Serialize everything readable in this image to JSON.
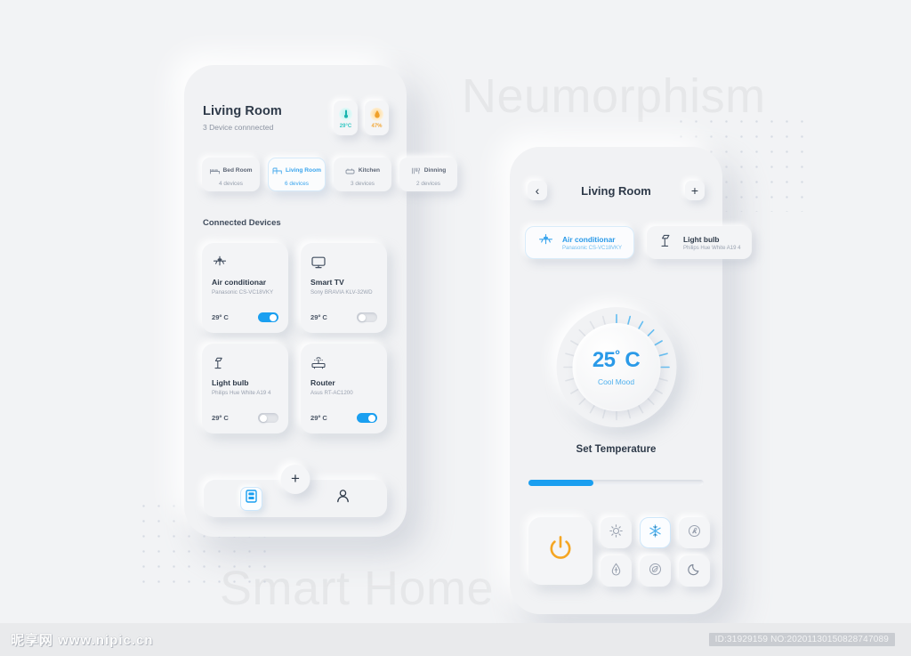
{
  "background": {
    "word_top": "Neumorphism",
    "word_bottom": "Smart Home",
    "page_bg": "#f2f3f5",
    "accent_blue": "#1a9ff0",
    "accent_orange": "#f2a93b"
  },
  "phone_one": {
    "title": "Living Room",
    "subtitle": "3 Device connnected",
    "sensors": [
      {
        "name": "temperature-sensor",
        "value": "29°C",
        "color": "#35c8c3"
      },
      {
        "name": "humidity-sensor",
        "value": "47%",
        "color": "#f2a93b"
      }
    ],
    "rooms": [
      {
        "name": "Bed Room",
        "count": "4 devices",
        "icon": "bed-icon",
        "active": false
      },
      {
        "name": "Living Room",
        "count": "6 devices",
        "icon": "sofa-icon",
        "active": true
      },
      {
        "name": "Kitchen",
        "count": "3 devices",
        "icon": "kitchen-icon",
        "active": false
      },
      {
        "name": "Dinning",
        "count": "2 devices",
        "icon": "dining-icon",
        "active": false
      }
    ],
    "section_title": "Connected Devices",
    "devices": [
      {
        "name": "Air conditionar",
        "model": "Panasonic CS-VC18VKY",
        "temp": "29º C",
        "on": true,
        "icon": "air-conditioner-icon"
      },
      {
        "name": "Smart TV",
        "model": "Sony BRAVIA KLV-32WD",
        "temp": "29º C",
        "on": false,
        "icon": "tv-icon"
      },
      {
        "name": "Light bulb",
        "model": "Philips Hue White A19 4",
        "temp": "29º C",
        "on": false,
        "icon": "lamp-icon"
      },
      {
        "name": "Router",
        "model": "Asus RT-AC1200",
        "temp": "29º C",
        "on": true,
        "icon": "router-icon"
      }
    ],
    "nav": {
      "dashboard_icon": "dashboard-icon",
      "add_label": "+",
      "profile_icon": "person-icon"
    }
  },
  "phone_two": {
    "back_label": "‹",
    "title": "Living Room",
    "add_label": "+",
    "device_pills": [
      {
        "name": "Air conditionar",
        "model": "Panasonic CS-VC18VKY",
        "icon": "air-conditioner-icon",
        "active": true
      },
      {
        "name": "Light bulb",
        "model": "Philips Hue White A19 4",
        "icon": "lamp-icon",
        "active": false
      }
    ],
    "dial": {
      "value": "25",
      "degree": "º",
      "unit": "C",
      "mood": "Cool Mood",
      "arc_percent": 27,
      "ticks": 24
    },
    "set_temperature_label": "Set Temperature",
    "slider_percent": 37,
    "power_button": {
      "icon": "power-icon",
      "color": "#f5a623"
    },
    "modes": [
      {
        "name": "heat-mode",
        "icon": "sun-icon",
        "active": false
      },
      {
        "name": "cool-mode",
        "icon": "snowflake-icon",
        "active": true
      },
      {
        "name": "fan-mode",
        "icon": "fan-icon",
        "active": false
      },
      {
        "name": "dry-mode",
        "icon": "droplet-icon",
        "active": false
      },
      {
        "name": "eco-mode",
        "icon": "eco-icon",
        "active": false
      },
      {
        "name": "sleep-mode",
        "icon": "moon-icon",
        "active": false
      }
    ]
  },
  "watermark": {
    "logo": "昵享网 www.nipic.cn",
    "id_text": "ID:31929159 NO:20201130150828747089"
  }
}
